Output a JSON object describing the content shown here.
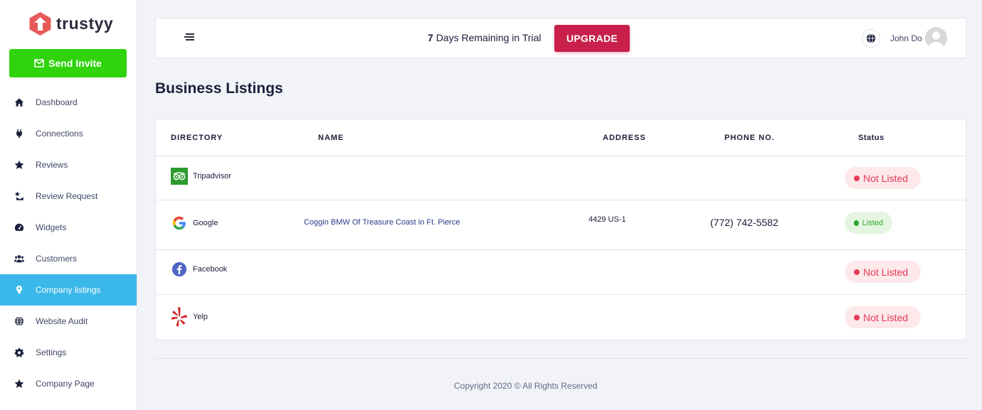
{
  "app": {
    "logo_text": "trustyy",
    "brand_color": "#e85a5a"
  },
  "sidebar": {
    "send_invite_label": "Send Invite",
    "items": [
      {
        "label": "Dashboard",
        "icon": "home-icon"
      },
      {
        "label": "Connections",
        "icon": "plug-icon"
      },
      {
        "label": "Reviews",
        "icon": "star-icon"
      },
      {
        "label": "Review Request",
        "icon": "envelope-star-icon"
      },
      {
        "label": "Widgets",
        "icon": "gauge-icon"
      },
      {
        "label": "Customers",
        "icon": "users-icon"
      },
      {
        "label": "Company listings",
        "icon": "map-pin-icon",
        "active": true
      },
      {
        "label": "Website Audit",
        "icon": "globe-icon"
      },
      {
        "label": "Settings",
        "icon": "gear-icon"
      },
      {
        "label": "Company Page",
        "icon": "star-icon"
      }
    ],
    "active_color": "#3ab8ea"
  },
  "topbar": {
    "trial_days": "7",
    "trial_text": "Days Remaining in Trial",
    "upgrade_label": "UPGRADE",
    "upgrade_color": "#c8204a",
    "user_name": "John Do"
  },
  "page": {
    "title": "Business Listings"
  },
  "table": {
    "headers": [
      "DIRECTORY",
      "NAME",
      "ADDRESS",
      "PHONE NO.",
      "Status"
    ],
    "rows": [
      {
        "directory": "Tripadvisor",
        "icon": "tripadvisor-icon",
        "name": "",
        "address": "",
        "phone": "",
        "status": "Not Listed"
      },
      {
        "directory": "Google",
        "icon": "google-icon",
        "name": "Coggin BMW Of Treasure Coast in Ft. Pierce",
        "address": "4429 US-1",
        "phone": "(772) 742-5582",
        "status": "Listed"
      },
      {
        "directory": "Facebook",
        "icon": "facebook-icon",
        "name": "",
        "address": "",
        "phone": "",
        "status": "Not Listed"
      },
      {
        "directory": "Yelp",
        "icon": "yelp-icon",
        "name": "",
        "address": "",
        "phone": "",
        "status": "Not Listed"
      }
    ]
  },
  "footer": {
    "copyright": "Copyright 2020 © All Rights Reserved"
  }
}
